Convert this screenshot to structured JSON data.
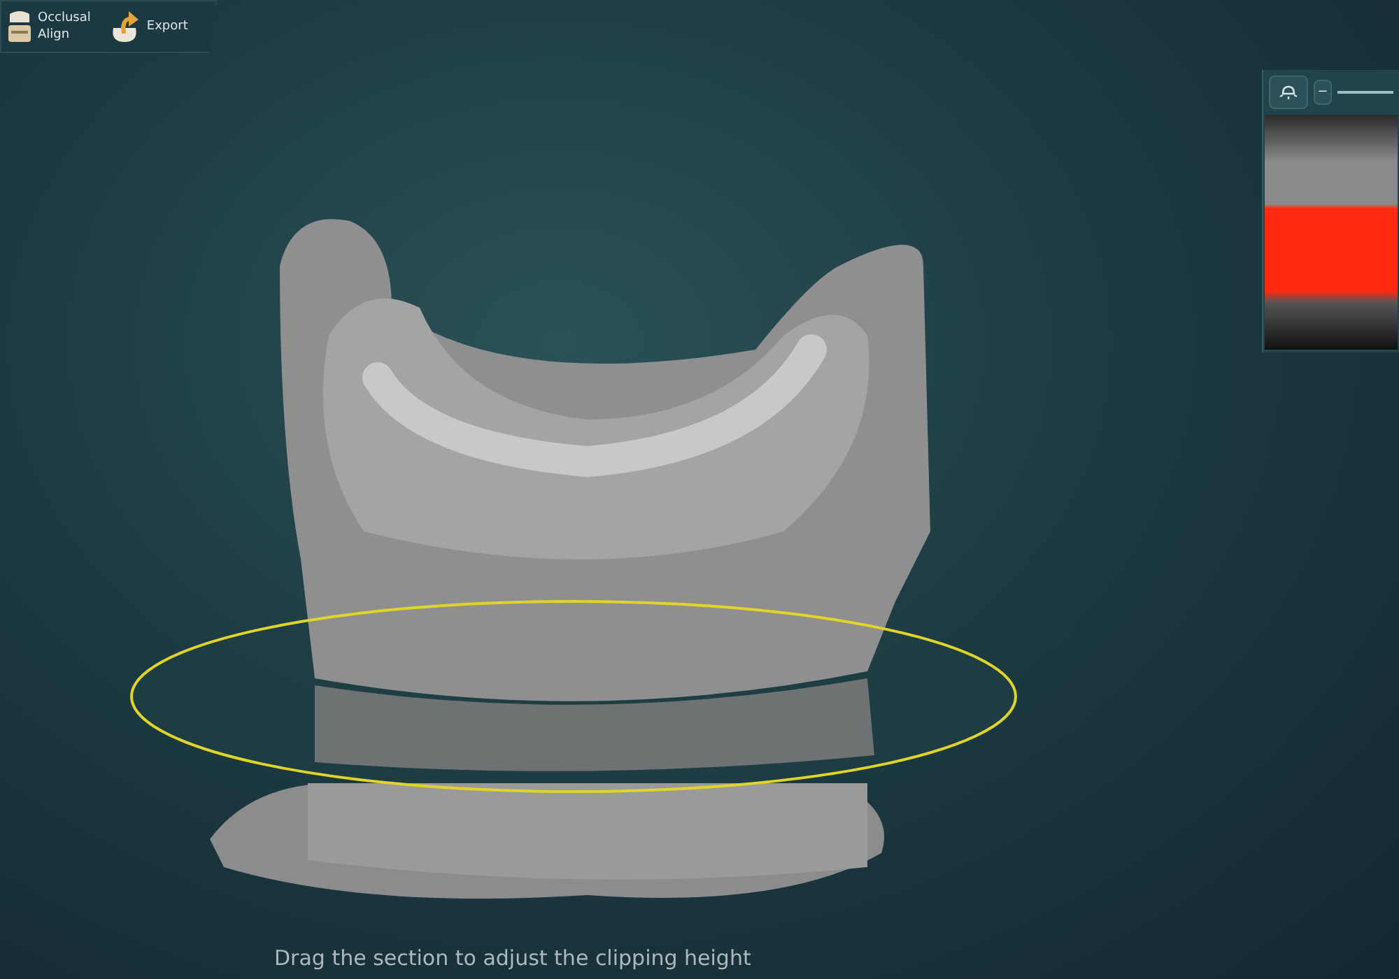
{
  "toolbar": [
    {
      "label_lines": [
        "Occlusal",
        "Align"
      ],
      "kind": "occlusal"
    },
    {
      "label_lines": [
        "Export"
      ],
      "kind": "export"
    }
  ],
  "preview_panel": {
    "zoom_out_button": "−"
  },
  "hint": "Drag the section to adjust the clipping height"
}
